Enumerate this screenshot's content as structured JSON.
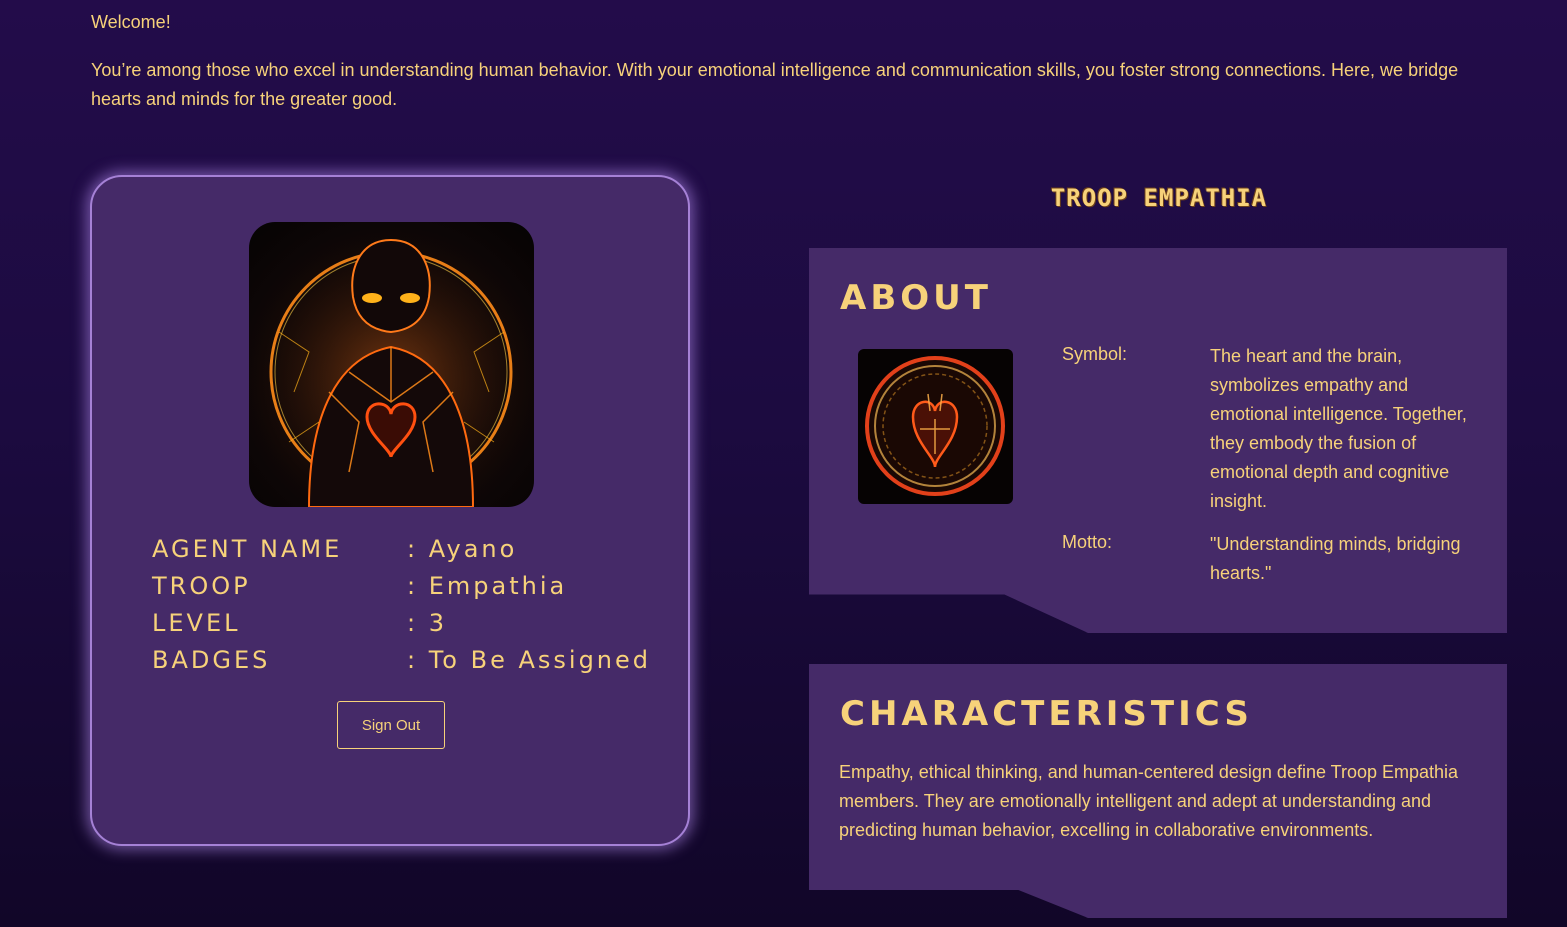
{
  "welcome": {
    "title": "Welcome!",
    "text": "You’re among those who excel in understanding human behavior. With your emotional intelligence and communication skills, you foster strong connections. Here, we bridge hearts and minds for the greater good."
  },
  "agent": {
    "rows": [
      {
        "label": "AGENT NAME",
        "value": ": Ayano"
      },
      {
        "label": "TROOP",
        "value": ": Empathia"
      },
      {
        "label": "LEVEL",
        "value": ": 3"
      },
      {
        "label": "BADGES",
        "value": ": To Be Assigned"
      }
    ],
    "signout_label": "Sign Out"
  },
  "troop": {
    "title": "TROOP EMPATHIA",
    "about": {
      "heading": "ABOUT",
      "symbol_label": "Symbol:",
      "symbol_value": "The heart and the brain, symbolizes empathy and emotional intelligence. Together, they embody the fusion of emotional depth and cognitive insight.",
      "motto_label": "Motto:",
      "motto_value": "\"Understanding minds, bridging hearts.\""
    },
    "characteristics": {
      "heading": "CHARACTERISTICS",
      "text": "Empathy, ethical thinking, and human-centered design define Troop Empathia members. They are emotionally intelligent and adept at understanding and predicting human behavior, excelling in collaborative environments."
    }
  },
  "colors": {
    "accent": "#f7d27a",
    "panel": "#452a68",
    "background": "#1c0b40",
    "glow": "#a581d6"
  }
}
